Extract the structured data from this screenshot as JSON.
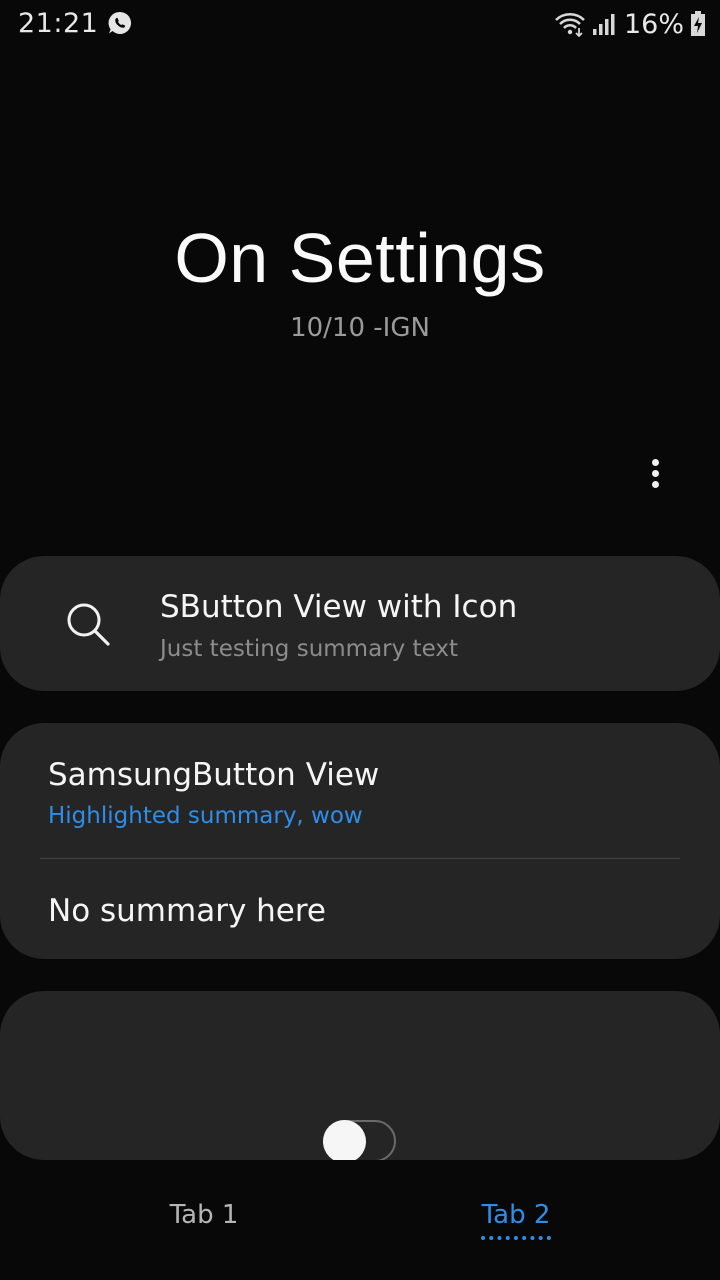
{
  "status_bar": {
    "time": "21:21",
    "battery_percent": "16%",
    "icons": [
      "whatsapp-icon",
      "wifi-icon",
      "cell-signal-icon",
      "battery-charging-icon"
    ]
  },
  "header": {
    "title": "On Settings",
    "subtitle": "10/10 -IGN"
  },
  "card1": {
    "icon": "search-icon",
    "title": "SButton View with Icon",
    "summary": "Just testing summary text"
  },
  "card2": {
    "item1": {
      "title": "SamsungButton View",
      "summary": "Highlighted summary, wow"
    },
    "item2": {
      "title": "No summary here"
    }
  },
  "card3": {
    "toggle_on": false
  },
  "tabs": [
    {
      "label": "Tab 1",
      "selected": false
    },
    {
      "label": "Tab 2",
      "selected": true
    }
  ],
  "colors": {
    "background": "#080808",
    "card": "#252525",
    "accent": "#2f8de8"
  }
}
